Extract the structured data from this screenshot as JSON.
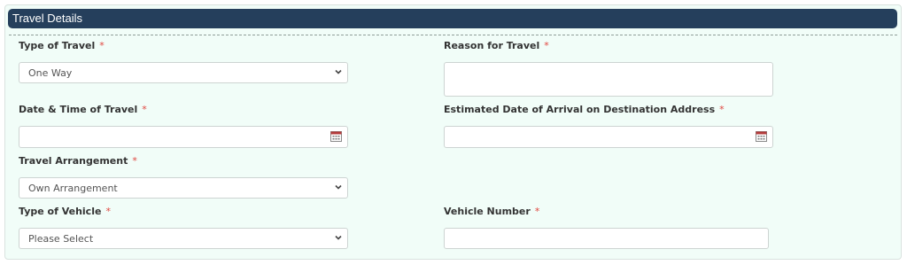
{
  "section": {
    "title": "Travel Details"
  },
  "required_marker": "*",
  "fields": {
    "type_of_travel": {
      "label": "Type of Travel",
      "value": "One Way"
    },
    "reason_for_travel": {
      "label": "Reason for Travel",
      "value": ""
    },
    "date_time_of_travel": {
      "label": "Date & Time of Travel",
      "value": ""
    },
    "estimated_arrival": {
      "label": "Estimated Date of Arrival on Destination Address",
      "value": ""
    },
    "travel_arrangement": {
      "label": "Travel Arrangement",
      "value": "Own Arrangement"
    },
    "type_of_vehicle": {
      "label": "Type of Vehicle",
      "value": "Please Select"
    },
    "vehicle_number": {
      "label": "Vehicle Number",
      "value": ""
    }
  },
  "icons": {
    "dropdown": "chevron-down-icon",
    "calendar": "calendar-icon"
  },
  "colors": {
    "header_bg": "#253f5c",
    "panel_bg": "#f1fdf8",
    "required": "#e0463f",
    "calendar_accent": "#b33a3a"
  }
}
